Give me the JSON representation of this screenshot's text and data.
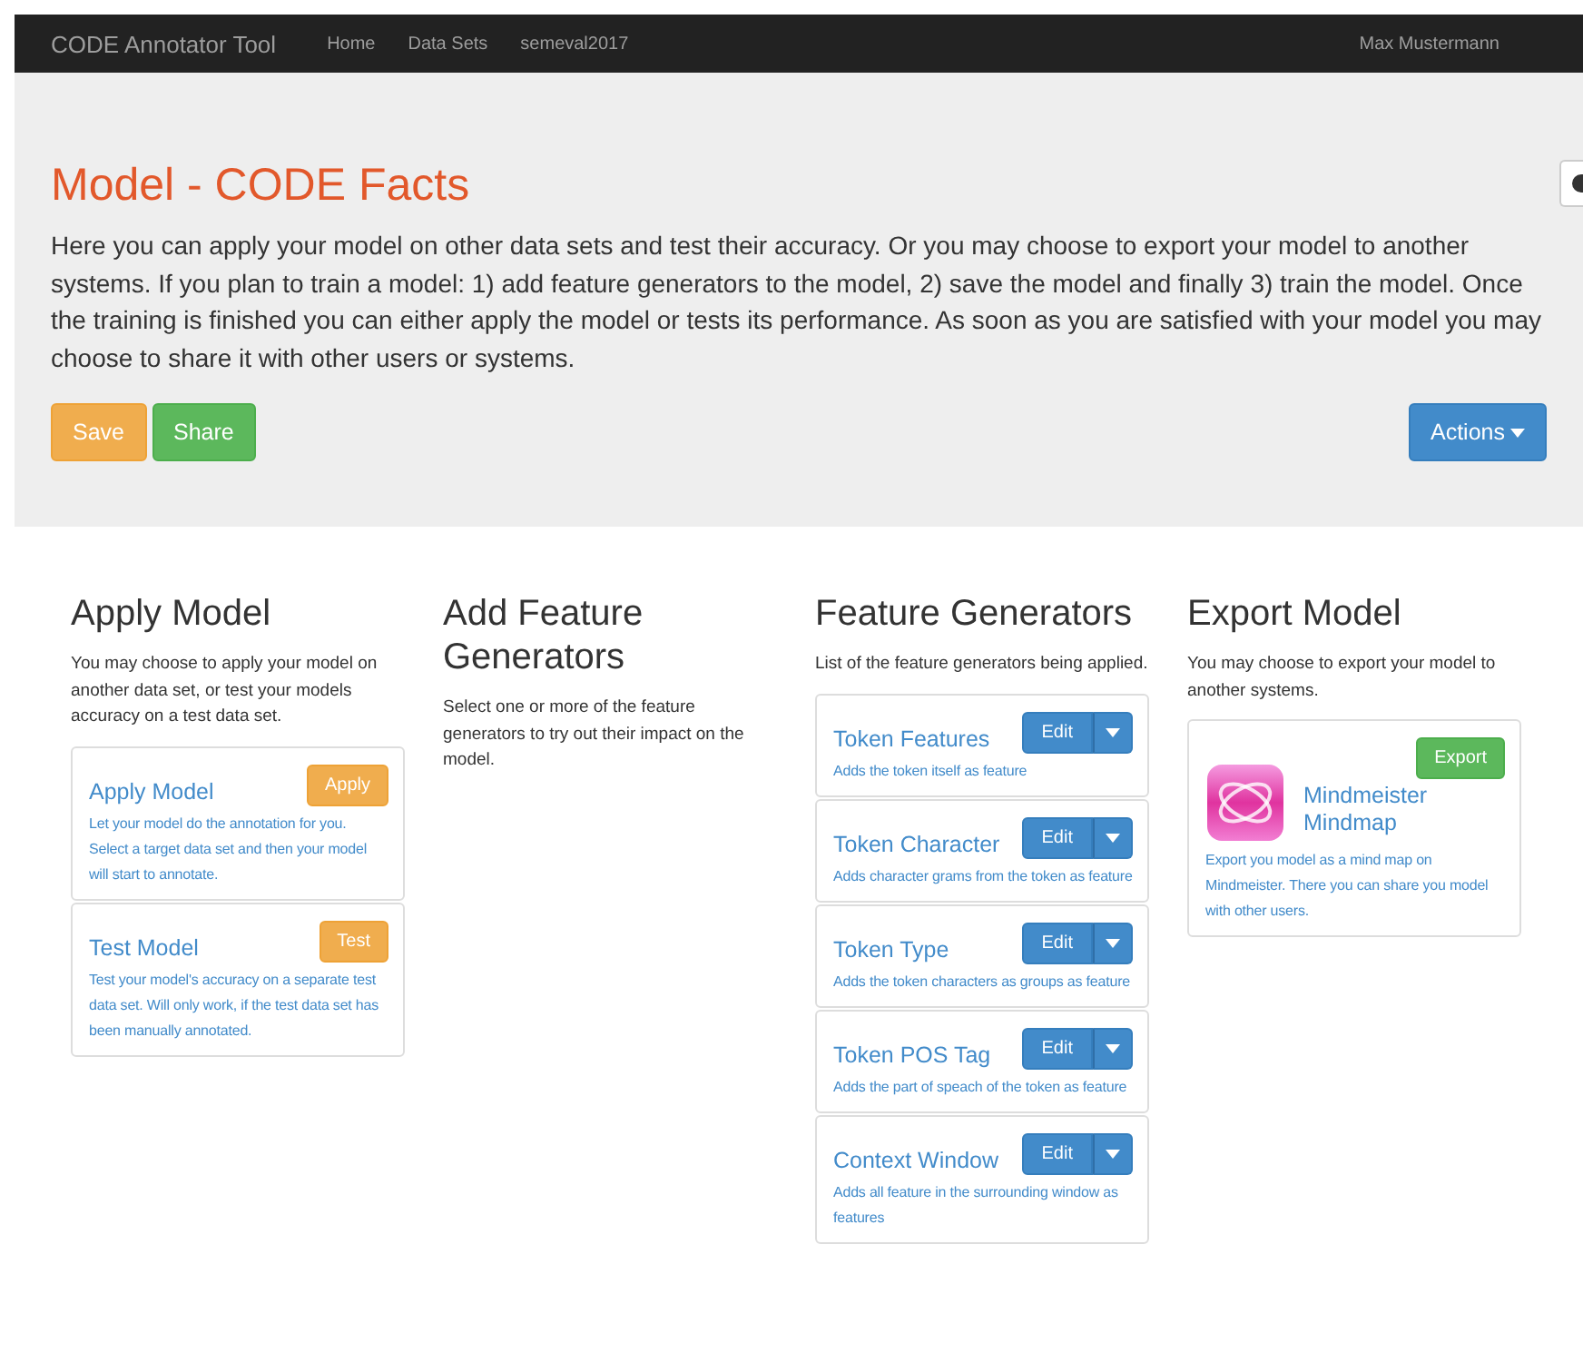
{
  "navbar": {
    "brand": "CODE Annotator Tool",
    "links": [
      "Home",
      "Data Sets",
      "semeval2017"
    ],
    "user": "Max Mustermann"
  },
  "header": {
    "title": "Model - CODE Facts",
    "text": "Here you can apply your model on other data sets and test their accuracy. Or you may choose to export your model to another systems. If you plan to train a model: 1) add feature generators to the model, 2) save the model and finally 3) train the model. Once the training is finished you can either apply the model or tests its performance. As soon as you are satisfied with your model you may choose to share it with other users or systems.",
    "buttons": [
      {
        "label": "Save",
        "kind": "warning"
      },
      {
        "label": "Share",
        "kind": "success"
      }
    ],
    "actions": "Actions"
  },
  "columns": [
    {
      "title": "Apply Model",
      "text": "You may choose to apply your model on another data set, or test your models accuracy on a test data set.",
      "cards": [
        {
          "title": "Apply Model",
          "button": "Apply",
          "kind": "warning",
          "text": "Let your model do the annotation for you. Select a target data set and then your model will start to annotate."
        },
        {
          "title": "Test Model",
          "button": "Test",
          "kind": "warning",
          "text": "Test your model's accuracy on a separate test data set. Will only work, if the test data set has been manually annotated."
        }
      ]
    },
    {
      "title": "Add Feature Generators",
      "text": "Select one or more of the feature generators to try out their impact on the model."
    },
    {
      "title": "Feature Generators",
      "text": "List of the feature generators being applied.",
      "cards": [
        {
          "title": "Token Features",
          "button": "Edit",
          "kind": "split",
          "text": "Adds the token itself as feature"
        },
        {
          "title": "Token Character",
          "button": "Edit",
          "kind": "split",
          "text": "Adds character grams from the token as feature"
        },
        {
          "title": "Token Type",
          "button": "Edit",
          "kind": "split",
          "text": "Adds the token characters as groups as feature"
        },
        {
          "title": "Token POS Tag",
          "button": "Edit",
          "kind": "split",
          "text": "Adds the part of speach of the token as feature"
        },
        {
          "title": "Context Window",
          "button": "Edit",
          "kind": "split",
          "text": "Adds all feature in the surrounding window as features"
        }
      ]
    },
    {
      "title": "Export Model",
      "text": "You may choose to export your model to another systems.",
      "cards": [
        {
          "title": "Mindmeister Mindmap",
          "button": "Export",
          "kind": "export",
          "text": "Export you model as a mind map on Mindmeister. There you can share you model with other users."
        }
      ]
    }
  ]
}
